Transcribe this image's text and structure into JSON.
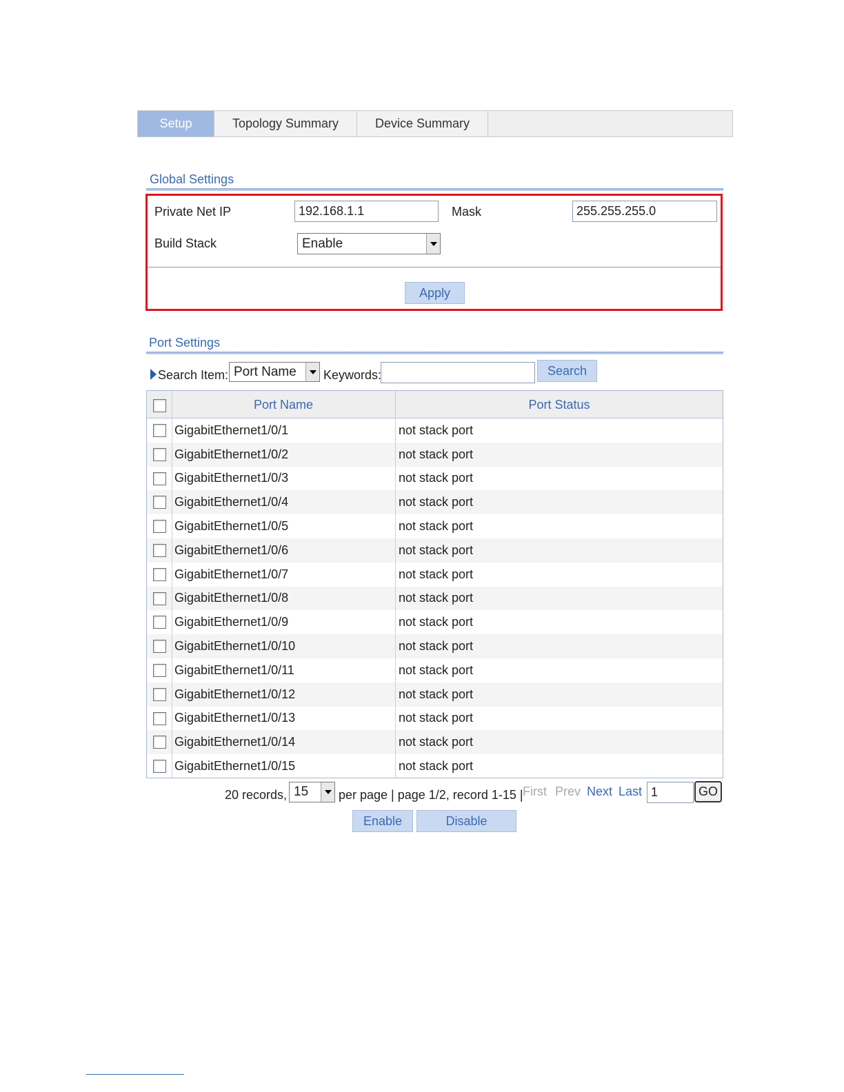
{
  "tabs": [
    {
      "label": "Setup",
      "active": true
    },
    {
      "label": "Topology Summary",
      "active": false
    },
    {
      "label": "Device Summary",
      "active": false
    }
  ],
  "global_settings": {
    "title": "Global Settings",
    "private_ip_label": "Private Net IP",
    "private_ip_value": "192.168.1.1",
    "mask_label": "Mask",
    "mask_value": "255.255.255.0",
    "build_stack_label": "Build Stack",
    "build_stack_value": "Enable",
    "apply_label": "Apply"
  },
  "port_settings": {
    "title": "Port Settings",
    "search_item_label": "Search Item:",
    "search_item_value": "Port Name",
    "keywords_label": "Keywords:",
    "keywords_value": "",
    "search_button": "Search"
  },
  "table": {
    "columns": [
      "Port Name",
      "Port Status"
    ],
    "rows": [
      {
        "port": "GigabitEthernet1/0/1",
        "status": "not stack port"
      },
      {
        "port": "GigabitEthernet1/0/2",
        "status": "not stack port"
      },
      {
        "port": "GigabitEthernet1/0/3",
        "status": "not stack port"
      },
      {
        "port": "GigabitEthernet1/0/4",
        "status": "not stack port"
      },
      {
        "port": "GigabitEthernet1/0/5",
        "status": "not stack port"
      },
      {
        "port": "GigabitEthernet1/0/6",
        "status": "not stack port"
      },
      {
        "port": "GigabitEthernet1/0/7",
        "status": "not stack port"
      },
      {
        "port": "GigabitEthernet1/0/8",
        "status": "not stack port"
      },
      {
        "port": "GigabitEthernet1/0/9",
        "status": "not stack port"
      },
      {
        "port": "GigabitEthernet1/0/10",
        "status": "not stack port"
      },
      {
        "port": "GigabitEthernet1/0/11",
        "status": "not stack port"
      },
      {
        "port": "GigabitEthernet1/0/12",
        "status": "not stack port"
      },
      {
        "port": "GigabitEthernet1/0/13",
        "status": "not stack port"
      },
      {
        "port": "GigabitEthernet1/0/14",
        "status": "not stack port"
      },
      {
        "port": "GigabitEthernet1/0/15",
        "status": "not stack port"
      }
    ]
  },
  "pagination": {
    "records_text": "20 records,",
    "per_page_value": "15",
    "page_info": "per page | page 1/2, record 1-15 |",
    "first": "First",
    "prev": "Prev",
    "next": "Next",
    "last": "Last",
    "page_input": "1",
    "go": "GO"
  },
  "actions": {
    "enable": "Enable",
    "disable": "Disable"
  },
  "colors": {
    "accent": "#3a6ab0",
    "active_tab": "#9fb9e3",
    "highlight_border": "#e0141e",
    "button_bg": "#c9d9f2"
  }
}
